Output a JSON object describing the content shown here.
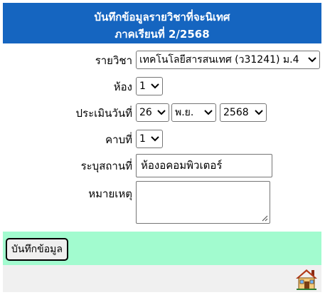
{
  "header": {
    "title": "บันทึกข้อมูลรายวิชาที่จะนิเทศ",
    "semester": "ภาคเรียนที่ 2/2568"
  },
  "form": {
    "subject": {
      "label": "รายวิชา",
      "value": "เทคโนโลยีสารสนเทศ (ว31241) ม.4"
    },
    "room": {
      "label": "ห้อง",
      "value": "1"
    },
    "assess_date": {
      "label": "ประเมินวันที่",
      "day": "26",
      "month": "พ.ย.",
      "year": "2568"
    },
    "period": {
      "label": "คาบที่",
      "value": "1"
    },
    "location": {
      "label": "ระบุสถานที่",
      "value": "ห้องอคอมพิวเตอร์"
    },
    "note": {
      "label": "หมายเหตุ",
      "value": ""
    }
  },
  "actions": {
    "save_label": "บันทึกข้อมูล"
  },
  "footer": {
    "home_icon": "home-icon"
  },
  "colors": {
    "header_bg": "#1565c0",
    "submit_bg": "#a2fbcf",
    "footer_bg": "#f0f0f0"
  }
}
